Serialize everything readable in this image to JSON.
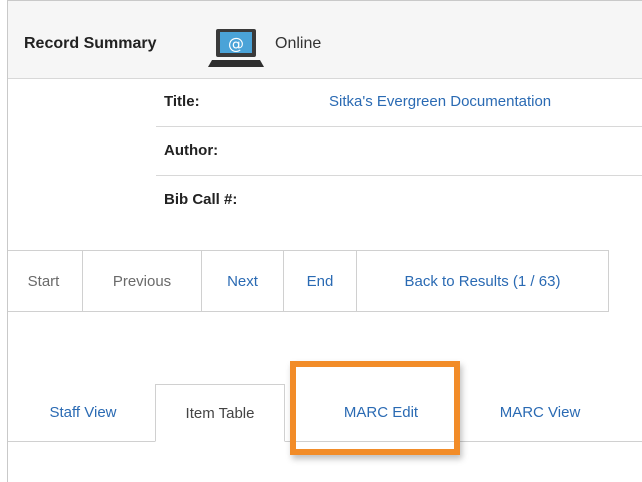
{
  "summary": {
    "title": "Record Summary",
    "status": "Online",
    "status_icon": "computer-at-icon"
  },
  "bib": {
    "rows": [
      {
        "label": "Title:",
        "value": "Sitka's Evergreen Documentation"
      },
      {
        "label": "Author:",
        "value": ""
      },
      {
        "label": "Bib Call #:",
        "value": ""
      }
    ]
  },
  "pager": {
    "start": "Start",
    "previous": "Previous",
    "next": "Next",
    "end": "End",
    "back": "Back to Results (1 / 63)"
  },
  "tabs": [
    {
      "label": "Staff View"
    },
    {
      "label": "Item Table"
    },
    {
      "label": "MARC Edit"
    },
    {
      "label": "MARC View"
    }
  ],
  "colors": {
    "link": "#2a6ab3",
    "highlight": "#f28c28"
  }
}
